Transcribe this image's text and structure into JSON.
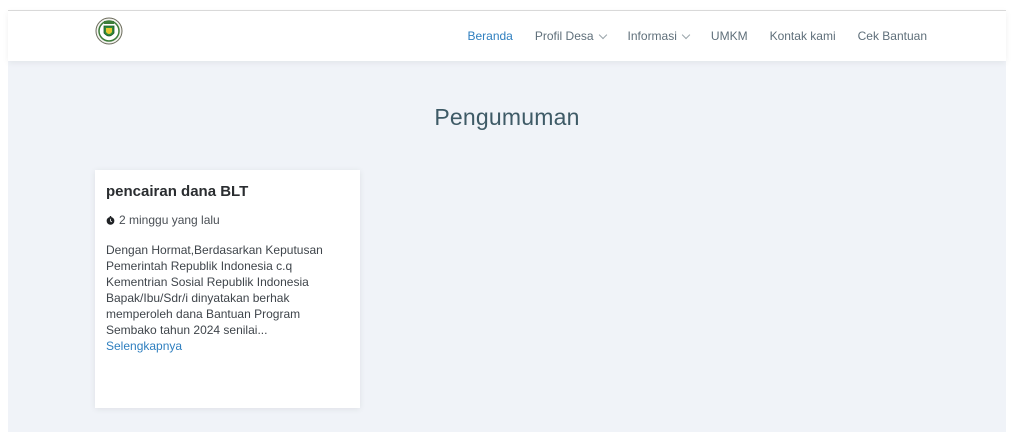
{
  "nav": {
    "items": [
      {
        "label": "Beranda",
        "active": true,
        "dropdown": false
      },
      {
        "label": "Profil Desa",
        "active": false,
        "dropdown": true
      },
      {
        "label": "Informasi",
        "active": false,
        "dropdown": true
      },
      {
        "label": "UMKM",
        "active": false,
        "dropdown": false
      },
      {
        "label": "Kontak kami",
        "active": false,
        "dropdown": false
      },
      {
        "label": "Cek Bantuan",
        "active": false,
        "dropdown": false
      }
    ],
    "logo_icon": "village-emblem-icon"
  },
  "page": {
    "title": "Pengumuman"
  },
  "announcements": [
    {
      "title": "pencairan dana BLT",
      "time_icon": "clock-icon",
      "time": "2 minggu yang lalu",
      "excerpt": "Dengan Hormat,Berdasarkan Keputusan Pemerintah Republik Indonesia c.q Kementrian Sosial Republik Indonesia Bapak/Ibu/Sdr/i dinyatakan berhak memperoleh dana Bantuan Program Sembako tahun 2024 senilai...",
      "more_label": "Selengkapnya"
    }
  ],
  "colors": {
    "accent": "#2f7fbf",
    "content_bg": "#f0f3f8",
    "title": "#3e5a66"
  }
}
